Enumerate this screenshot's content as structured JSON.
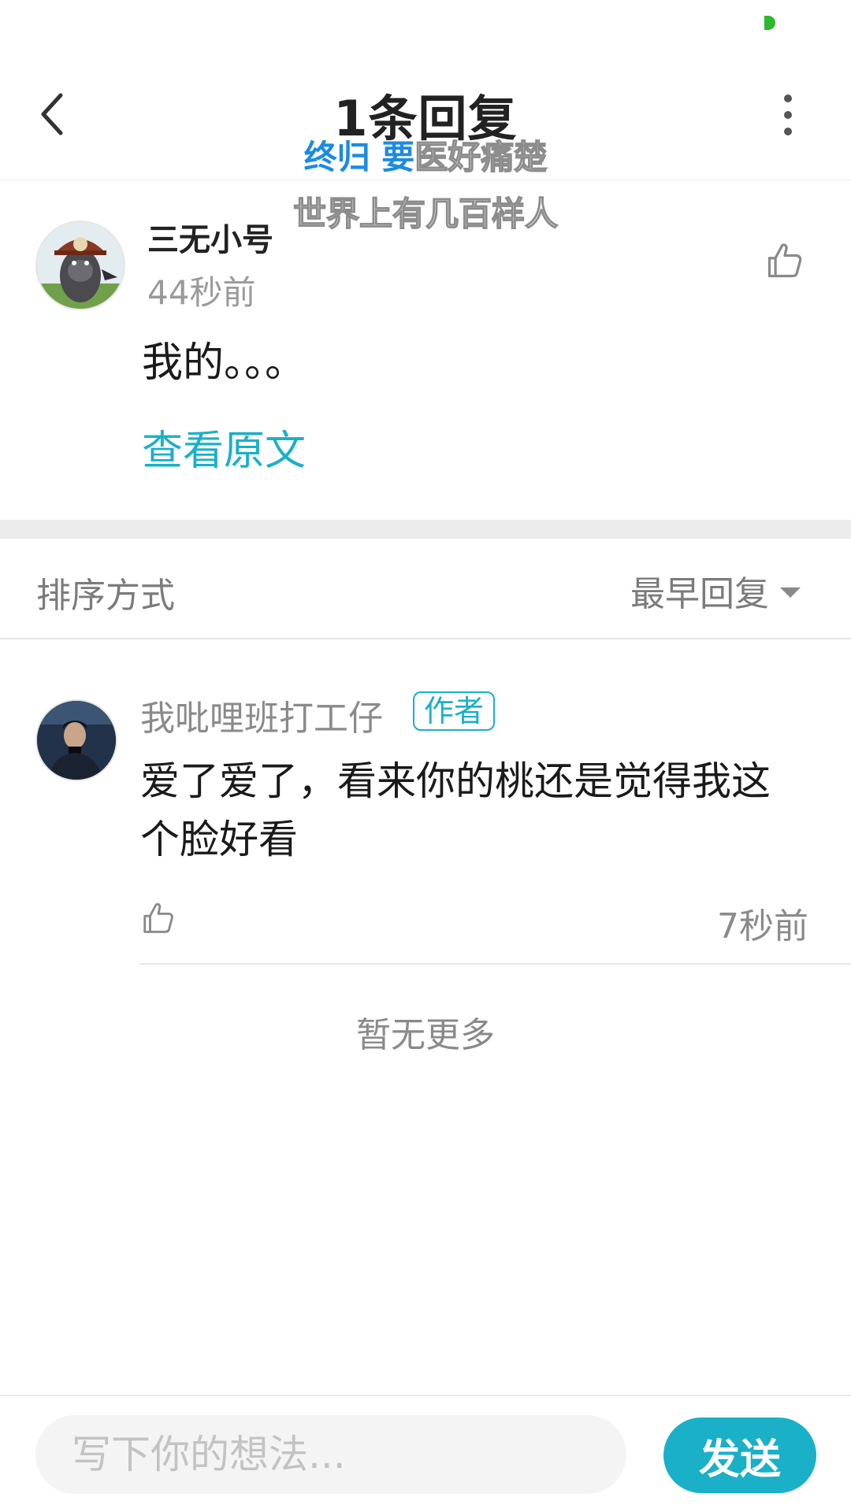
{
  "header": {
    "title": "1条回复",
    "overlay_line1_blue": "终归 要",
    "overlay_line1_white": "医好痛楚",
    "overlay_line2": "世界上有几百样人"
  },
  "original_post": {
    "author": "三无小号",
    "time": "44秒前",
    "content": "我的。。。",
    "view_original_label": "查看原文"
  },
  "sort": {
    "label": "排序方式",
    "selected": "最早回复"
  },
  "reply": {
    "author": "我吡哩班打工仔",
    "badge": "作者",
    "content": "爱了爱了，看来你的桃还是觉得我这个脸好看",
    "time": "7秒前"
  },
  "footer_text": "暂无更多",
  "compose": {
    "placeholder": "写下你的想法...",
    "send_label": "发送"
  },
  "colors": {
    "accent": "#1ab0c8",
    "status_dot": "#2db82d",
    "overlay_blue": "#1d8be0"
  },
  "icons": [
    "back-icon",
    "more-vertical-icon",
    "thumbs-up-icon",
    "chevron-down-icon"
  ]
}
